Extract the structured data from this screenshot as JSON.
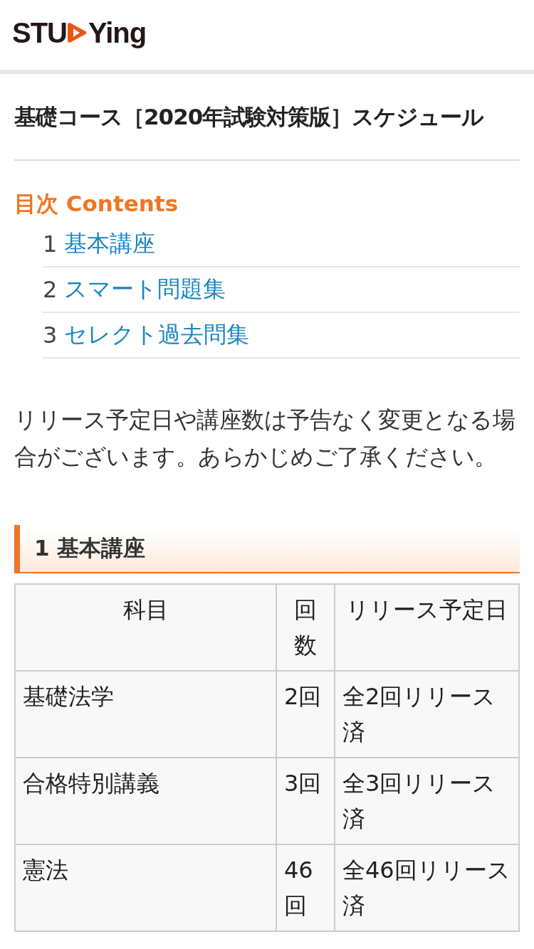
{
  "header": {
    "logo_left": "STU",
    "logo_right": "Ying"
  },
  "page_title": "基礎コース［2020年試験対策版］スケジュール",
  "toc": {
    "heading": "目次 Contents",
    "items": [
      {
        "number": "1",
        "label": "基本講座"
      },
      {
        "number": "2",
        "label": "スマート問題集"
      },
      {
        "number": "3",
        "label": "セレクト過去問集"
      }
    ]
  },
  "notice": "リリース予定日や講座数は予告なく変更となる場合がございます。あらかじめご了承ください。",
  "section": {
    "heading": "1 基本講座",
    "table": {
      "columns": [
        "科目",
        "回数",
        "リリース予定日"
      ],
      "rows": [
        [
          "基礎法学",
          "2回",
          "全2回リリース済"
        ],
        [
          "合格特別講義",
          "3回",
          "全3回リリース済"
        ],
        [
          "憲法",
          "46回",
          "全46回リリース済"
        ]
      ]
    }
  }
}
